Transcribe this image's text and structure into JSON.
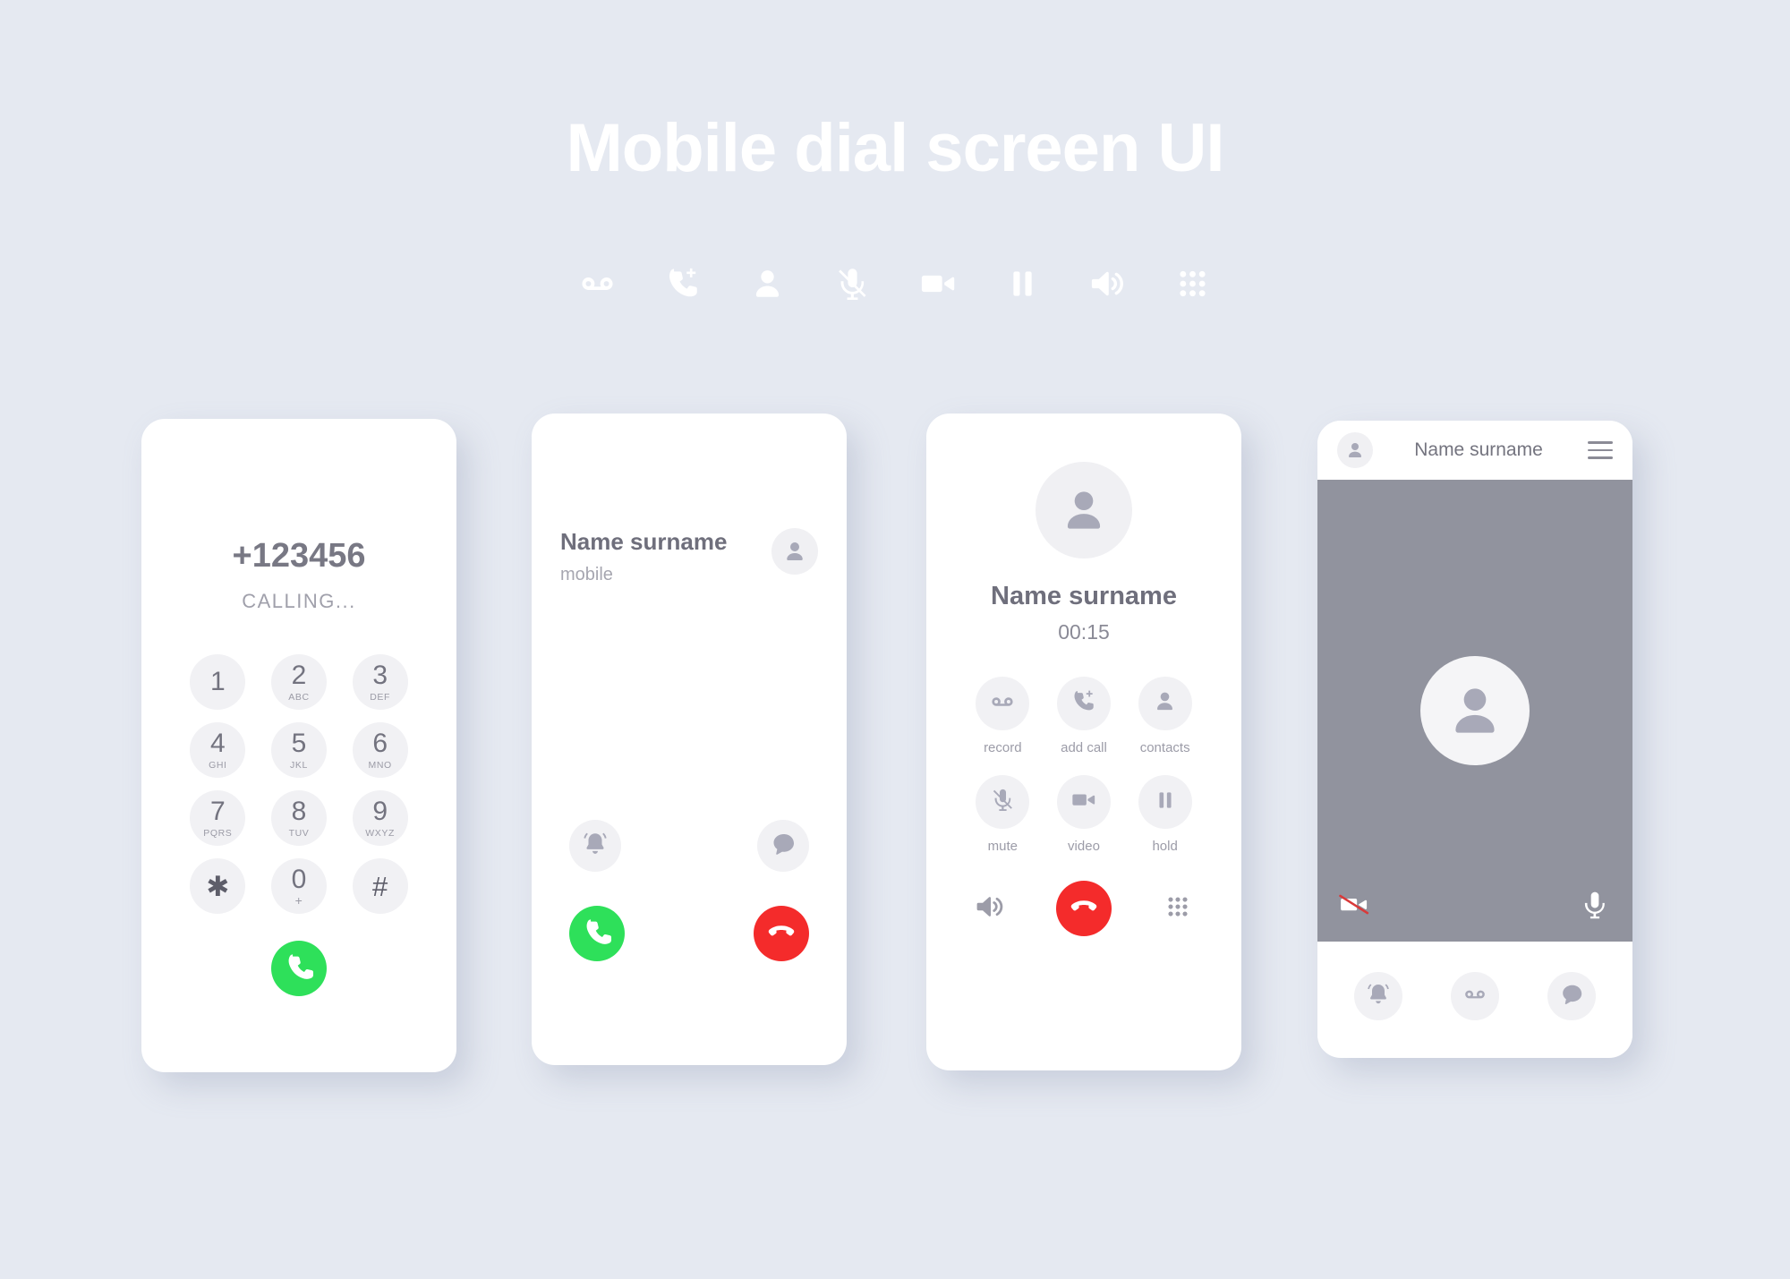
{
  "page": {
    "title": "Mobile dial screen UI",
    "background_color": "#e5e9f1",
    "title_color": "#ffffff"
  },
  "icon_strip": [
    {
      "name": "voicemail-icon",
      "label": "voicemail"
    },
    {
      "name": "add-call-icon",
      "label": "add call"
    },
    {
      "name": "contacts-icon",
      "label": "contacts"
    },
    {
      "name": "mute-icon",
      "label": "mute"
    },
    {
      "name": "video-icon",
      "label": "video"
    },
    {
      "name": "hold-icon",
      "label": "hold"
    },
    {
      "name": "speaker-icon",
      "label": "speaker"
    },
    {
      "name": "keypad-icon",
      "label": "keypad"
    }
  ],
  "colors": {
    "accept_green": "#2ee05a",
    "decline_red": "#f42b2b",
    "video_gray": "#91939e",
    "circle_gray": "#f1f1f4",
    "icon_gray": "#a8a9b8",
    "text_dark": "#6f6f7c",
    "text_light": "#a0a0ab"
  },
  "screen1": {
    "number": "+123456",
    "status": "CALLING...",
    "keys": [
      {
        "digit": "1",
        "letters": ""
      },
      {
        "digit": "2",
        "letters": "ABC"
      },
      {
        "digit": "3",
        "letters": "DEF"
      },
      {
        "digit": "4",
        "letters": "GHI"
      },
      {
        "digit": "5",
        "letters": "JKL"
      },
      {
        "digit": "6",
        "letters": "MNO"
      },
      {
        "digit": "7",
        "letters": "PQRS"
      },
      {
        "digit": "8",
        "letters": "TUV"
      },
      {
        "digit": "9",
        "letters": "WXYZ"
      },
      {
        "digit": "✱",
        "letters": ""
      },
      {
        "digit": "0",
        "letters": "+"
      },
      {
        "digit": "#",
        "letters": ""
      }
    ],
    "call_button": "call"
  },
  "screen2": {
    "name": "Name surname",
    "line_type": "mobile",
    "actions": [
      {
        "name": "ringer-bell-icon",
        "label": "ringer"
      },
      {
        "name": "message-bubble-icon",
        "label": "message"
      }
    ],
    "answer_button": "answer",
    "decline_button": "decline"
  },
  "screen3": {
    "name": "Name surname",
    "timer": "00:15",
    "actions": [
      {
        "icon": "record-icon",
        "label": "record"
      },
      {
        "icon": "add-call-icon",
        "label": "add call"
      },
      {
        "icon": "contacts-icon",
        "label": "contacts"
      },
      {
        "icon": "mute-icon",
        "label": "mute"
      },
      {
        "icon": "video-icon",
        "label": "video"
      },
      {
        "icon": "hold-icon",
        "label": "hold"
      }
    ],
    "bottom": {
      "speaker": "speaker",
      "end_call": "end call",
      "keypad": "keypad"
    }
  },
  "screen4": {
    "title": "Name surname",
    "menu": "menu",
    "video_controls": [
      {
        "name": "video-off-icon",
        "label": "video off"
      },
      {
        "name": "microphone-icon",
        "label": "microphone"
      }
    ],
    "footer": [
      {
        "name": "ringer-bell-icon",
        "label": "ringer"
      },
      {
        "name": "voicemail-icon",
        "label": "voicemail"
      },
      {
        "name": "message-bubble-icon",
        "label": "message"
      }
    ]
  }
}
